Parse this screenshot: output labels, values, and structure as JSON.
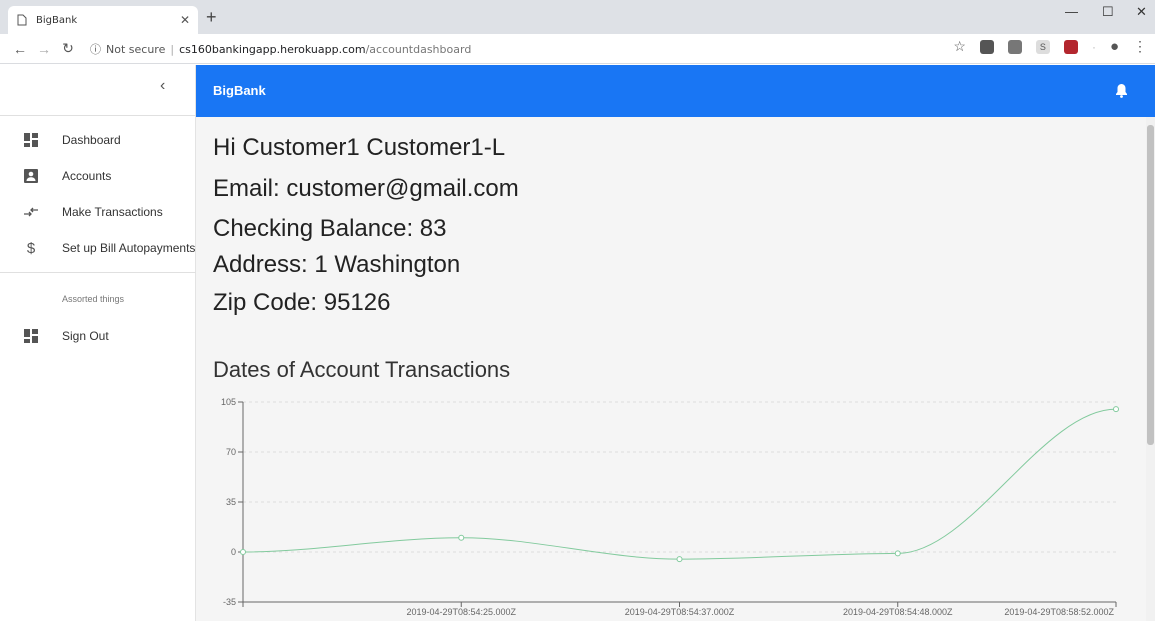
{
  "browser": {
    "tab_title": "BigBank",
    "url_security": "Not secure",
    "url_domain": "cs160bankingapp.herokuapp.com",
    "url_path": "/accountdashboard"
  },
  "app": {
    "brand": "BigBank"
  },
  "sidebar": {
    "items": [
      {
        "label": "Dashboard",
        "icon": "dashboard-icon"
      },
      {
        "label": "Accounts",
        "icon": "account-box-icon"
      },
      {
        "label": "Make Transactions",
        "icon": "swap-arrows-icon"
      },
      {
        "label": "Set up Bill Autopayments",
        "icon": "dollar-icon"
      }
    ],
    "subheader": "Assorted things",
    "secondary_items": [
      {
        "label": "Sign Out",
        "icon": "dashboard-icon"
      }
    ]
  },
  "profile": {
    "greeting": "Hi Customer1 Customer1-L",
    "email": "Email: customer@gmail.com",
    "balance": "Checking Balance: 83",
    "address": "Address: 1 Washington",
    "zip": "Zip Code: 95126"
  },
  "chart_title": "Dates of Account Transactions",
  "chart_data": {
    "type": "line",
    "title": "Dates of Account Transactions",
    "x": [
      "",
      "2019-04-29T08:54:25.000Z",
      "2019-04-29T08:54:37.000Z",
      "2019-04-29T08:54:48.000Z",
      "2019-04-29T08:58:52.000Z"
    ],
    "values": [
      0,
      10,
      -5,
      -1,
      100
    ],
    "ylim": [
      -35,
      105
    ],
    "yticks": [
      "105",
      "70",
      "35",
      "0",
      "-35"
    ],
    "grid": true,
    "color": "#82ca9d"
  }
}
